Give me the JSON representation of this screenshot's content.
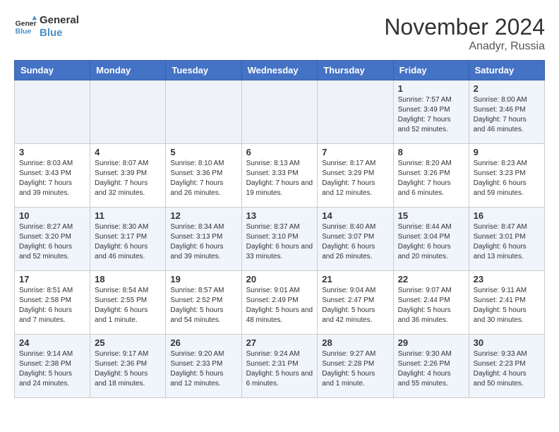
{
  "header": {
    "logo_line1": "General",
    "logo_line2": "Blue",
    "month": "November 2024",
    "location": "Anadyr, Russia"
  },
  "weekdays": [
    "Sunday",
    "Monday",
    "Tuesday",
    "Wednesday",
    "Thursday",
    "Friday",
    "Saturday"
  ],
  "weeks": [
    [
      {
        "day": "",
        "info": ""
      },
      {
        "day": "",
        "info": ""
      },
      {
        "day": "",
        "info": ""
      },
      {
        "day": "",
        "info": ""
      },
      {
        "day": "",
        "info": ""
      },
      {
        "day": "1",
        "info": "Sunrise: 7:57 AM\nSunset: 3:49 PM\nDaylight: 7 hours\nand 52 minutes."
      },
      {
        "day": "2",
        "info": "Sunrise: 8:00 AM\nSunset: 3:46 PM\nDaylight: 7 hours\nand 46 minutes."
      }
    ],
    [
      {
        "day": "3",
        "info": "Sunrise: 8:03 AM\nSunset: 3:43 PM\nDaylight: 7 hours\nand 39 minutes."
      },
      {
        "day": "4",
        "info": "Sunrise: 8:07 AM\nSunset: 3:39 PM\nDaylight: 7 hours\nand 32 minutes."
      },
      {
        "day": "5",
        "info": "Sunrise: 8:10 AM\nSunset: 3:36 PM\nDaylight: 7 hours\nand 26 minutes."
      },
      {
        "day": "6",
        "info": "Sunrise: 8:13 AM\nSunset: 3:33 PM\nDaylight: 7 hours\nand 19 minutes."
      },
      {
        "day": "7",
        "info": "Sunrise: 8:17 AM\nSunset: 3:29 PM\nDaylight: 7 hours\nand 12 minutes."
      },
      {
        "day": "8",
        "info": "Sunrise: 8:20 AM\nSunset: 3:26 PM\nDaylight: 7 hours\nand 6 minutes."
      },
      {
        "day": "9",
        "info": "Sunrise: 8:23 AM\nSunset: 3:23 PM\nDaylight: 6 hours\nand 59 minutes."
      }
    ],
    [
      {
        "day": "10",
        "info": "Sunrise: 8:27 AM\nSunset: 3:20 PM\nDaylight: 6 hours\nand 52 minutes."
      },
      {
        "day": "11",
        "info": "Sunrise: 8:30 AM\nSunset: 3:17 PM\nDaylight: 6 hours\nand 46 minutes."
      },
      {
        "day": "12",
        "info": "Sunrise: 8:34 AM\nSunset: 3:13 PM\nDaylight: 6 hours\nand 39 minutes."
      },
      {
        "day": "13",
        "info": "Sunrise: 8:37 AM\nSunset: 3:10 PM\nDaylight: 6 hours\nand 33 minutes."
      },
      {
        "day": "14",
        "info": "Sunrise: 8:40 AM\nSunset: 3:07 PM\nDaylight: 6 hours\nand 26 minutes."
      },
      {
        "day": "15",
        "info": "Sunrise: 8:44 AM\nSunset: 3:04 PM\nDaylight: 6 hours\nand 20 minutes."
      },
      {
        "day": "16",
        "info": "Sunrise: 8:47 AM\nSunset: 3:01 PM\nDaylight: 6 hours\nand 13 minutes."
      }
    ],
    [
      {
        "day": "17",
        "info": "Sunrise: 8:51 AM\nSunset: 2:58 PM\nDaylight: 6 hours\nand 7 minutes."
      },
      {
        "day": "18",
        "info": "Sunrise: 8:54 AM\nSunset: 2:55 PM\nDaylight: 6 hours\nand 1 minute."
      },
      {
        "day": "19",
        "info": "Sunrise: 8:57 AM\nSunset: 2:52 PM\nDaylight: 5 hours\nand 54 minutes."
      },
      {
        "day": "20",
        "info": "Sunrise: 9:01 AM\nSunset: 2:49 PM\nDaylight: 5 hours\nand 48 minutes."
      },
      {
        "day": "21",
        "info": "Sunrise: 9:04 AM\nSunset: 2:47 PM\nDaylight: 5 hours\nand 42 minutes."
      },
      {
        "day": "22",
        "info": "Sunrise: 9:07 AM\nSunset: 2:44 PM\nDaylight: 5 hours\nand 36 minutes."
      },
      {
        "day": "23",
        "info": "Sunrise: 9:11 AM\nSunset: 2:41 PM\nDaylight: 5 hours\nand 30 minutes."
      }
    ],
    [
      {
        "day": "24",
        "info": "Sunrise: 9:14 AM\nSunset: 2:38 PM\nDaylight: 5 hours\nand 24 minutes."
      },
      {
        "day": "25",
        "info": "Sunrise: 9:17 AM\nSunset: 2:36 PM\nDaylight: 5 hours\nand 18 minutes."
      },
      {
        "day": "26",
        "info": "Sunrise: 9:20 AM\nSunset: 2:33 PM\nDaylight: 5 hours\nand 12 minutes."
      },
      {
        "day": "27",
        "info": "Sunrise: 9:24 AM\nSunset: 2:31 PM\nDaylight: 5 hours\nand 6 minutes."
      },
      {
        "day": "28",
        "info": "Sunrise: 9:27 AM\nSunset: 2:28 PM\nDaylight: 5 hours\nand 1 minute."
      },
      {
        "day": "29",
        "info": "Sunrise: 9:30 AM\nSunset: 2:26 PM\nDaylight: 4 hours\nand 55 minutes."
      },
      {
        "day": "30",
        "info": "Sunrise: 9:33 AM\nSunset: 2:23 PM\nDaylight: 4 hours\nand 50 minutes."
      }
    ]
  ]
}
